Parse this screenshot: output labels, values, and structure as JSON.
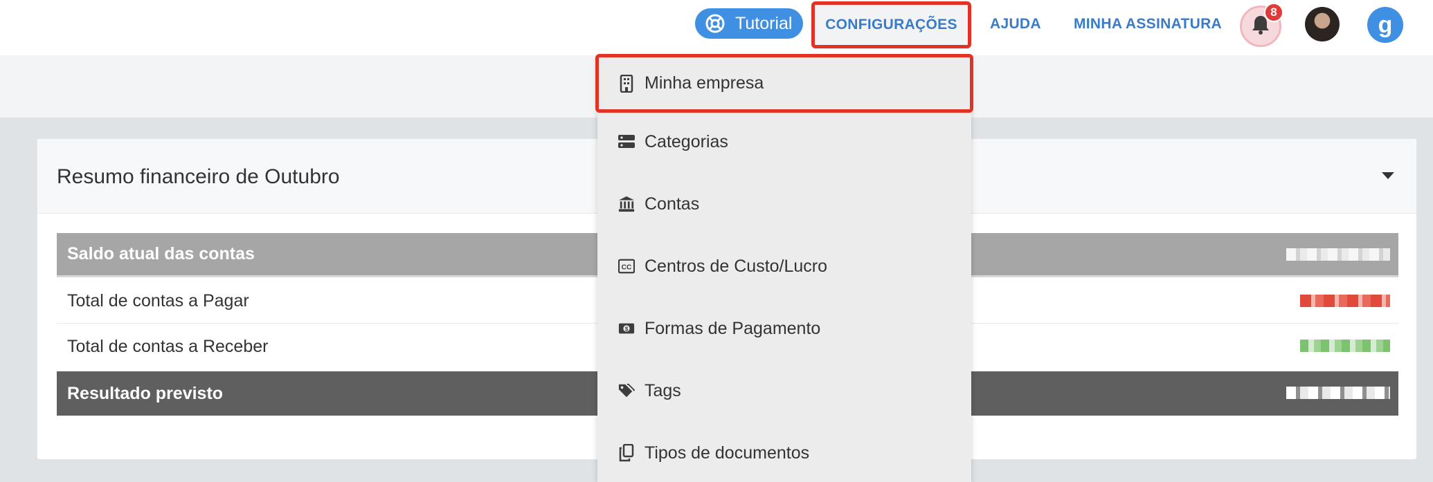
{
  "topbar": {
    "tutorial_label": "Tutorial",
    "nav": {
      "config": "CONFIGURAÇÕES",
      "ajuda": "AJUDA",
      "assinatura": "MINHA ASSINATURA"
    },
    "notifications_count": "8",
    "brand_letter": "g"
  },
  "card": {
    "title": "Resumo financeiro de Outubro",
    "rows": [
      {
        "label": "Saldo atual das contas"
      },
      {
        "label": "Total de contas a Pagar"
      },
      {
        "label": "Total de contas a Receber"
      },
      {
        "label": "Resultado previsto"
      }
    ]
  },
  "dropdown": {
    "items": [
      {
        "label": "Minha empresa",
        "icon": "building-icon"
      },
      {
        "label": "Categorias",
        "icon": "categories-icon"
      },
      {
        "label": "Contas",
        "icon": "bank-icon"
      },
      {
        "label": "Centros de Custo/Lucro",
        "icon": "cc-icon"
      },
      {
        "label": "Formas de Pagamento",
        "icon": "money-icon"
      },
      {
        "label": "Tags",
        "icon": "tags-icon"
      },
      {
        "label": "Tipos de documentos",
        "icon": "documents-icon"
      }
    ]
  },
  "colors": {
    "accent": "#3f8fe3",
    "highlight": "#e03325",
    "negative": "#e04a3a",
    "positive": "#7dc26f"
  }
}
